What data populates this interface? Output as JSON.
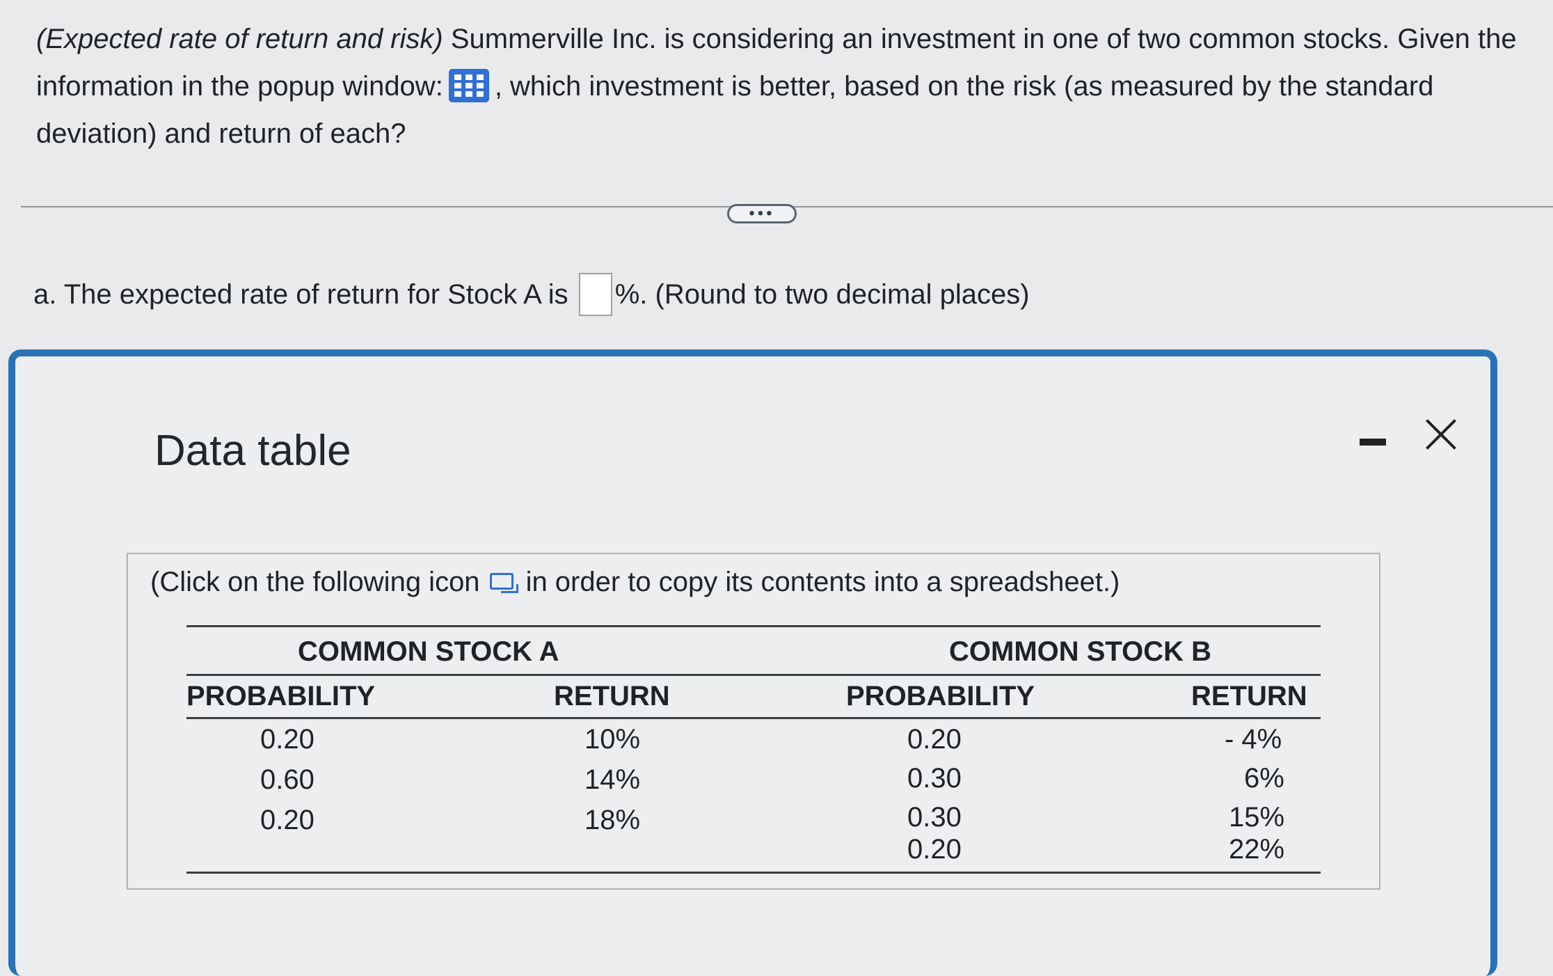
{
  "question": {
    "lead": "(Expected rate of return and risk)",
    "text_1": " Summerville Inc. is considering an investment in one of two common stocks. Given the information in the popup window:",
    "text_2": ", which investment is better, based on the risk (as measured by the standard deviation) and return of each?",
    "icon": "grid-icon"
  },
  "more_button": {
    "label": "•••"
  },
  "part_a": {
    "prefix": "a. The expected rate of return for Stock A is",
    "suffix": "%. (Round to two decimal places)",
    "answer_value": ""
  },
  "modal": {
    "title": "Data table",
    "minimize_icon": "minimize-icon",
    "close_icon": "close-icon",
    "copy_note_before": "(Click on the following icon",
    "copy_note_after": "in order to copy its contents into a spreadsheet.)",
    "copy_icon": "copy-icon"
  },
  "table": {
    "stock_a": {
      "title": "COMMON STOCK A",
      "col_probability": "PROBABILITY",
      "col_return": "RETURN",
      "rows": [
        {
          "probability": "0.20",
          "return": "10%"
        },
        {
          "probability": "0.60",
          "return": "14%"
        },
        {
          "probability": "0.20",
          "return": "18%"
        }
      ]
    },
    "stock_b": {
      "title": "COMMON STOCK B",
      "col_probability": "PROBABILITY",
      "col_return": "RETURN",
      "rows": [
        {
          "probability": "0.20",
          "return": "- 4%"
        },
        {
          "probability": "0.30",
          "return": "6%"
        },
        {
          "probability": "0.30",
          "return": "15%"
        },
        {
          "probability": "0.20",
          "return": "22%"
        }
      ]
    }
  }
}
